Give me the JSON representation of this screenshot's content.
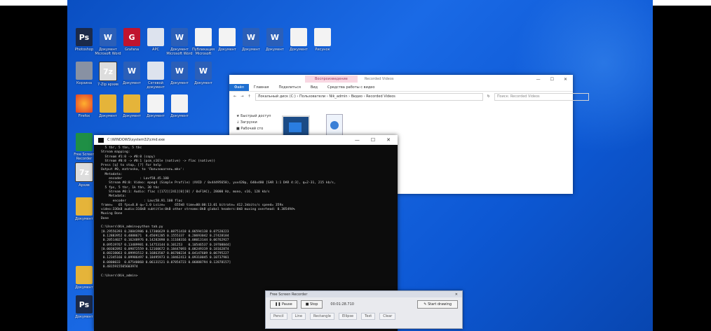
{
  "desktop": {
    "icons": [
      {
        "glyph": "Ps",
        "label": "Photoshop"
      },
      {
        "glyph": "W",
        "label": "Документ Microsoft Word"
      },
      {
        "glyph": "G",
        "label": "Grafana"
      },
      {
        "glyph": "",
        "label": "APC"
      },
      {
        "glyph": "W",
        "label": "Документ Microsoft Word"
      },
      {
        "glyph": "",
        "label": "Публикация Microsoft"
      },
      {
        "glyph": "",
        "label": "Документ"
      },
      {
        "glyph": "W",
        "label": "Документ"
      },
      {
        "glyph": "W",
        "label": "Документ"
      },
      {
        "glyph": "",
        "label": "Документ"
      },
      {
        "glyph": "",
        "label": "Рисунок"
      },
      {
        "glyph": "",
        "label": "Корзина"
      },
      {
        "glyph": "7z",
        "label": "7-Zip архив"
      },
      {
        "glyph": "W",
        "label": "Документ"
      },
      {
        "glyph": "",
        "label": "Сетевой документ"
      },
      {
        "glyph": "W",
        "label": "Документ"
      },
      {
        "glyph": "W",
        "label": "Документ"
      },
      {
        "glyph": "",
        "label": "Firefox"
      },
      {
        "glyph": "",
        "label": "Документ"
      },
      {
        "glyph": "",
        "label": "Документ"
      },
      {
        "glyph": "",
        "label": "Документ"
      },
      {
        "glyph": "",
        "label": "Документ"
      },
      {
        "glyph": "",
        "label": "Free Screen Recorder"
      },
      {
        "glyph": "7z",
        "label": "Архив"
      },
      {
        "glyph": "",
        "label": "Документ"
      },
      {
        "glyph": "",
        "label": "Документ"
      },
      {
        "glyph": "Ps",
        "label": "Документ"
      }
    ]
  },
  "explorer": {
    "context_tab": "Воспроизведение",
    "title": "Recorded Videos",
    "ribbon": [
      "Файл",
      "Главная",
      "Поделиться",
      "Вид",
      "Средства работы с видео"
    ],
    "path": "Локальный диск (C:) › Пользователи › Nik_admin › Видео › Recorded Videos",
    "search_placeholder": "Поиск: Recorded Videos",
    "nav": [
      "Быстрый доступ",
      "Загрузки",
      "Рабочий сто"
    ],
    "controls": [
      "—",
      "☐",
      "✕"
    ]
  },
  "cmd": {
    "title": "C:\\WINDOWS\\system32\\cmd.exe",
    "controls": [
      "—",
      "☐",
      "✕"
    ],
    "lines": [
      "  5 tbr, 5 tbn, 5 tbc",
      "Stream mapping:",
      "  Stream #1:0 -> #0:0 (copy)",
      "  Stream #0:0 -> #0:1 (pcm_s16le (native) -> flac (native))",
      "Press [q] to stop, [?] for help",
      "Output #0, matroska, to 'Пользователь.mkv':",
      "  Metadata:",
      "    encoder         : Lavf58.45.100",
      "    Stream #0:0: Video: mpeg4 (Simple Profile) (XVID / 0x44495658), yuv420p, 640x480 [SAR 1:1 DAR 4:3], q=2-31, 215 kb/s,",
      "  5 fps, 5 tbr, 1k tbn, 30 tbc",
      "    Stream #0:1: Audio: flac ([172][241][0][0] / 0xF1AC), 28000 Hz, mono, s16, 128 kb/s",
      "    Metadata:",
      "      encoder         : Lavc58.91.100 flac",
      "frame=   65 fps=0.0 q=-1.0 Lsize=     655kB time=00:00:13.01 bitrate= 412.1kbits/s speed= 359x",
      "video:336kB audio:316kB subtitle:0kB other streams:0kB global headers:0kB muxing overhead: 0.385494%",
      "Muxing Done",
      "Done",
      "",
      "C:\\Users\\Nik_admin>python tab.py",
      "[0.29556393 0.20843986 0.17306629 0.08751418 0.06594138 0.07520223",
      " 0.12883952 0.4888671  0.45691205 0.1555337  0.20693042 0.27428184",
      " 0.20514027 0.16248976 0.14282898 0.11168316 0.08013144 0.06762927",
      " 0.09519767 0.13489981 0.14753144 0.101253   0.10546537 0.19708844]",
      "[0.00302892 0.09872559 0.12160672 0.18447093 0.08249319 0.18162874",
      " 0.08238063 0.09993512 0.16863507 0.06700234 0.04147609 0.06795227",
      " 0.12345166 0.09986497 0.18495973 0.18462413 0.09310045 0.10737901",
      " 0.0800033  0.07540068 0.06131521 0.07854723 0.06888794 0.12878157]",
      " 0.4815915505603974",
      "",
      "C:\\Users\\Nik_admin>"
    ]
  },
  "recorder": {
    "title": "Free Screen Recorder",
    "pause_label": "Pause",
    "stop_label": "Stop",
    "time": "00:01:28.710",
    "start_label": "Start drawing",
    "tools": [
      "Pencil",
      "Line",
      "Rectangle",
      "Ellipse",
      "Text",
      "Clear"
    ]
  }
}
